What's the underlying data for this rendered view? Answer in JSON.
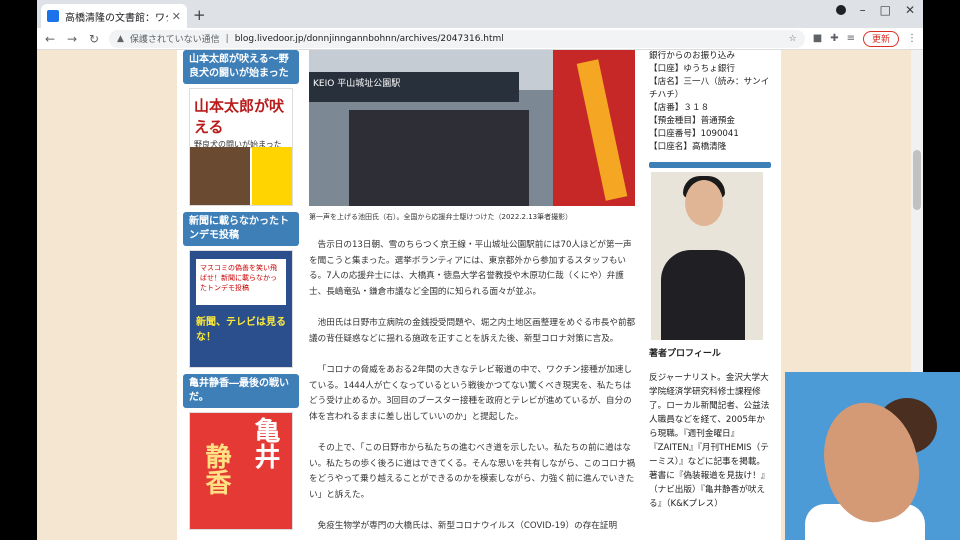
{
  "browser": {
    "tab_title": "高橋清隆の文書館：ワクチン接種を",
    "new_tab": "+",
    "window_controls": [
      "–",
      "□",
      "✕"
    ],
    "security_label": "保護されていない通信",
    "url": "blog.livedoor.jp/donnjinngannbohnn/archives/2047316.html",
    "update_label": "更新"
  },
  "left_sidebar": {
    "head1": "山本太郎が吠える～野良犬の闘いが始まった",
    "book1_title": "山本太郎が吠える",
    "book1_sub": "野良犬の闘いが始まった",
    "head2": "新聞に載らなかったトンデモ投稿",
    "book2_text": "マスコミの偽善を笑い飛ばせ！新聞に載らなかったトンデモ投稿",
    "book2_sub": "新聞、テレビは見るな！",
    "head3": "亀井静香―最後の戦いだ。",
    "book3_a": "亀井",
    "book3_b": "静香"
  },
  "main": {
    "photo_sign": "KEIO 平山城址公園駅",
    "caption": "第一声を上げる池田氏（右）。全国から応援弁士駆けつけた（2022.2.13筆者撮影）",
    "paragraphs": [
      "告示日の13日朝、雪のちらつく京王線・平山城址公園駅前には70人ほどが第一声を聞こうと集まった。選挙ボランティアには、東京都外から参加するスタッフもいる。7人の応援弁士には、大橋真・徳島大学名誉教授や木原功仁哉（くにや）弁護士、長嶋竜弘・鎌倉市議など全国的に知られる面々が並ぶ。",
      "池田氏は日野市立病院の金銭授受問題や、堀之内土地区画整理をめぐる市長や前都議の背任疑惑などに揺れる施政を正すことを訴えた後、新型コロナ対策に言及。",
      "「コロナの脅威をあおる2年間の大きなテレビ報道の中で、ワクチン接種が加速している。1444人が亡くなっているという戦後かつてない驚くべき現実を、私たちはどう受け止めるか。3回目のブースター接種を政府とテレビが進めているが、自分の体を言われるままに差し出していいのか」と提起した。",
      "その上で、「この日野市から私たちの進むべき道を示したい。私たちの前に道はない。私たちの歩く後ろに道はできてくる。そんな思いを共有しながら、このコロナ禍をどうやって乗り越えることができるのかを模索しながら、力強く前に進んでいきたい」と訴えた。",
      "免疫生物学が専門の大橋氏は、新型コロナウイルス（COVID-19）の存在証明"
    ]
  },
  "right_sidebar": {
    "bank_lines": [
      "銀行からのお振り込み",
      "【口座】ゆうちょ銀行",
      "【店名】三一八（読み：サンイチハチ）",
      "【店番】３１８",
      "【預金種目】普通預金",
      "【口座番号】1090041",
      "【口座名】高橋清隆"
    ],
    "profile_title": "著者プロフィール",
    "bio": "反ジャーナリスト。金沢大学大学院経済学研究科修士課程修了。ローカル新聞記者、公益法人職員などを経て、2005年から現職。『週刊金曜日』『ZAITEN』『月刊THEMIS（テーミス）』などに記事を掲載。著書に『偽装報道を見抜け！』（ナビ出版）『亀井静香が吠える』（K&Kプレス）"
  },
  "colors": {
    "accent": "#3f7fb8",
    "page_bg": "#f5e6d1"
  }
}
